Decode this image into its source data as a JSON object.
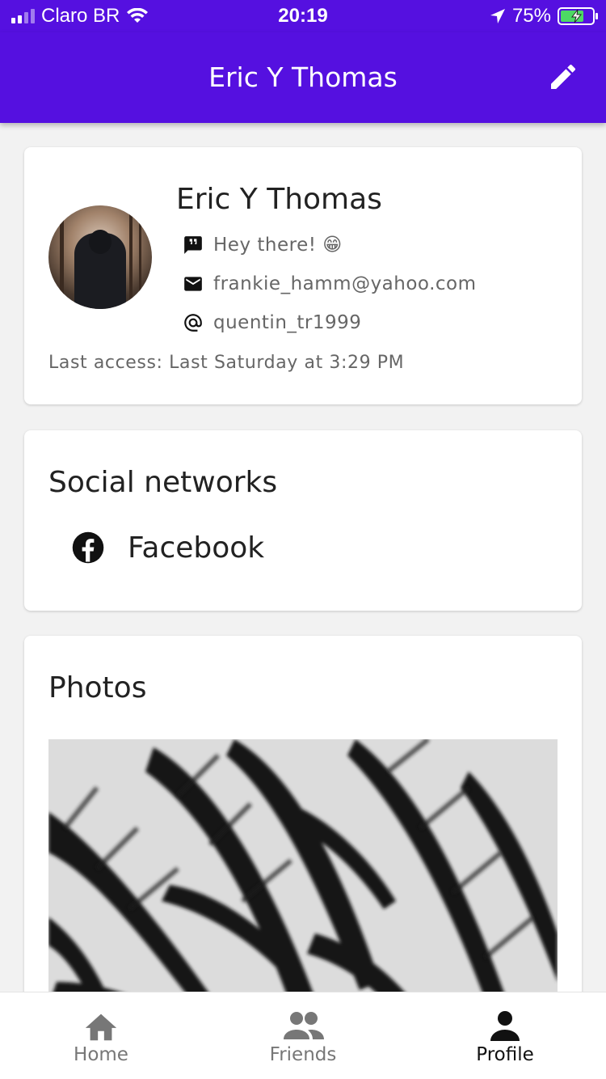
{
  "status_bar": {
    "carrier": "Claro BR",
    "time": "20:19",
    "battery": "75%"
  },
  "app_bar": {
    "title": "Eric Y Thomas",
    "edit_icon": "pencil-icon"
  },
  "profile": {
    "name": "Eric Y Thomas",
    "status": "Hey there! 😁",
    "email": "frankie_hamm@yahoo.com",
    "username": "quentin_tr1999",
    "last_access": "Last access: Last Saturday at 3:29 PM"
  },
  "social": {
    "title": "Social networks",
    "items": [
      {
        "label": "Facebook",
        "icon": "facebook-icon"
      }
    ]
  },
  "photos": {
    "title": "Photos"
  },
  "bottom_nav": {
    "items": [
      {
        "label": "Home",
        "icon": "home-icon"
      },
      {
        "label": "Friends",
        "icon": "people-icon"
      },
      {
        "label": "Profile",
        "icon": "person-icon"
      }
    ],
    "active": "Profile"
  },
  "colors": {
    "primary": "#5510e0",
    "background": "#f2f2f2"
  }
}
